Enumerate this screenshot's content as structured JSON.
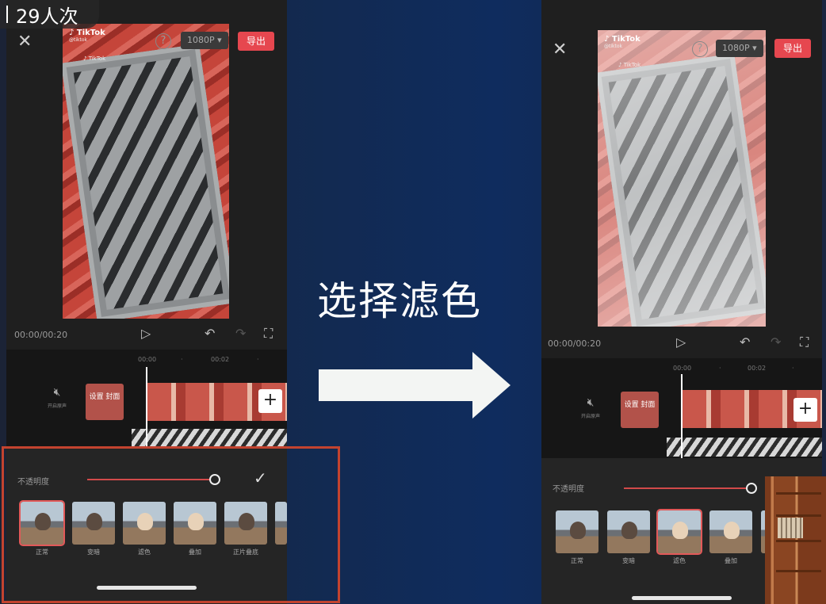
{
  "viewer_count": "29人次",
  "caption": "选择滤色",
  "left_phone": {
    "export_label": "导出",
    "resolution": "1080P",
    "help": "?",
    "watermark_brand": "TikTok",
    "time": "00:00/00:20",
    "ruler": [
      "00:00",
      "00:02"
    ],
    "mute_label": "开启原声",
    "cover_label": "设置 封面",
    "opacity_label": "不透明度",
    "opacity_value": 1.0,
    "blend_modes": [
      "正常",
      "变暗",
      "滤色",
      "叠加",
      "正片叠底"
    ],
    "selected_mode": "正常"
  },
  "right_phone": {
    "export_label": "导出",
    "resolution": "1080P",
    "help": "?",
    "watermark_brand": "TikTok",
    "time": "00:00/00:20",
    "ruler": [
      "00:00",
      "00:02"
    ],
    "mute_label": "开启原声",
    "cover_label": "设置 封面",
    "opacity_label": "不透明度",
    "opacity_value": 1.0,
    "blend_modes": [
      "正常",
      "变暗",
      "滤色",
      "叠加"
    ],
    "selected_mode": "滤色"
  },
  "icons": {
    "close": "close-icon",
    "play": "play-icon",
    "undo": "undo-icon",
    "redo": "redo-icon",
    "fullscreen": "fullscreen-icon",
    "mute": "speaker-mute-icon",
    "add": "plus-icon",
    "confirm": "checkmark-icon"
  },
  "colors": {
    "accent_red": "#e6474f",
    "slider": "#d24a4a",
    "highlight_box": "#c3432f"
  }
}
